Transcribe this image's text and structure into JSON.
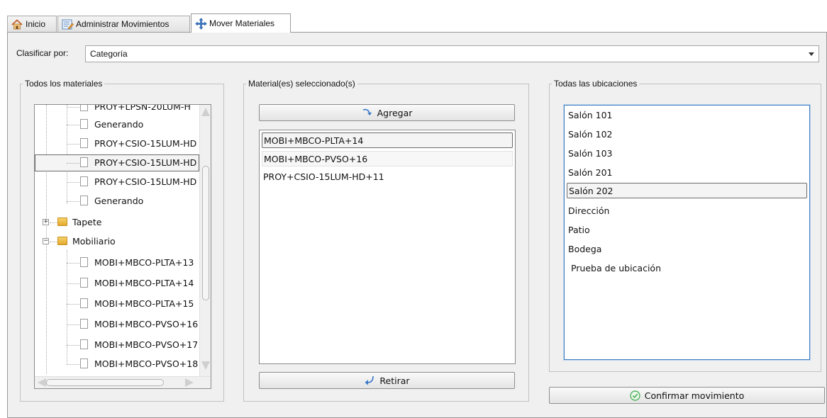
{
  "tabs": [
    {
      "label": "Inicio",
      "icon": "home-icon"
    },
    {
      "label": "Administrar Movimientos",
      "icon": "edit-list-icon"
    },
    {
      "label": "Mover Materiales",
      "icon": "move-arrows-icon",
      "active": true
    }
  ],
  "classify": {
    "label": "Clasificar por:",
    "value": "Categoría"
  },
  "materials_panel": {
    "legend": "Todos los materiales",
    "tree": [
      {
        "label": "PROY+LPSN-20LUM-H",
        "type": "file",
        "partial": true
      },
      {
        "label": "Generando",
        "type": "file"
      },
      {
        "label": "PROY+CSIO-15LUM-HD",
        "type": "file"
      },
      {
        "label": "PROY+CSIO-15LUM-HD",
        "type": "file",
        "selected": true
      },
      {
        "label": "PROY+CSIO-15LUM-HD",
        "type": "file"
      },
      {
        "label": "Generando",
        "type": "file"
      },
      {
        "label": "Tapete",
        "type": "folder",
        "expanded": false
      },
      {
        "label": "Mobiliario",
        "type": "folder",
        "expanded": true
      },
      {
        "label": "MOBI+MBCO-PLTA+13",
        "type": "file"
      },
      {
        "label": "MOBI+MBCO-PLTA+14",
        "type": "file"
      },
      {
        "label": "MOBI+MBCO-PLTA+15",
        "type": "file"
      },
      {
        "label": "MOBI+MBCO-PVSO+16",
        "type": "file"
      },
      {
        "label": "MOBI+MBCO-PVSO+17",
        "type": "file"
      },
      {
        "label": "MOBI+MBCO-PVSO+18",
        "type": "file"
      }
    ]
  },
  "selected_panel": {
    "legend": "Material(es) seleccionado(s)",
    "add_label": "Agregar",
    "remove_label": "Retirar",
    "items": [
      "MOBI+MBCO-PLTA+14",
      "MOBI+MBCO-PVSO+16",
      "PROY+CSIO-15LUM-HD+11"
    ]
  },
  "locations_panel": {
    "legend": "Todas las ubicaciones",
    "items": [
      "Salón 101",
      "Salón 102",
      "Salón 103",
      "Salón 201",
      "Salón 202",
      "Dirección",
      "Patio",
      "Bodega",
      " Prueba de ubicación"
    ],
    "selected": "Salón 202"
  },
  "confirm_label": "Confirmar movimiento",
  "colors": {
    "focus_border": "#3d7bbf",
    "folder": "#e4a92d",
    "check": "#3aa84a",
    "arrow": "#3a78c8"
  }
}
